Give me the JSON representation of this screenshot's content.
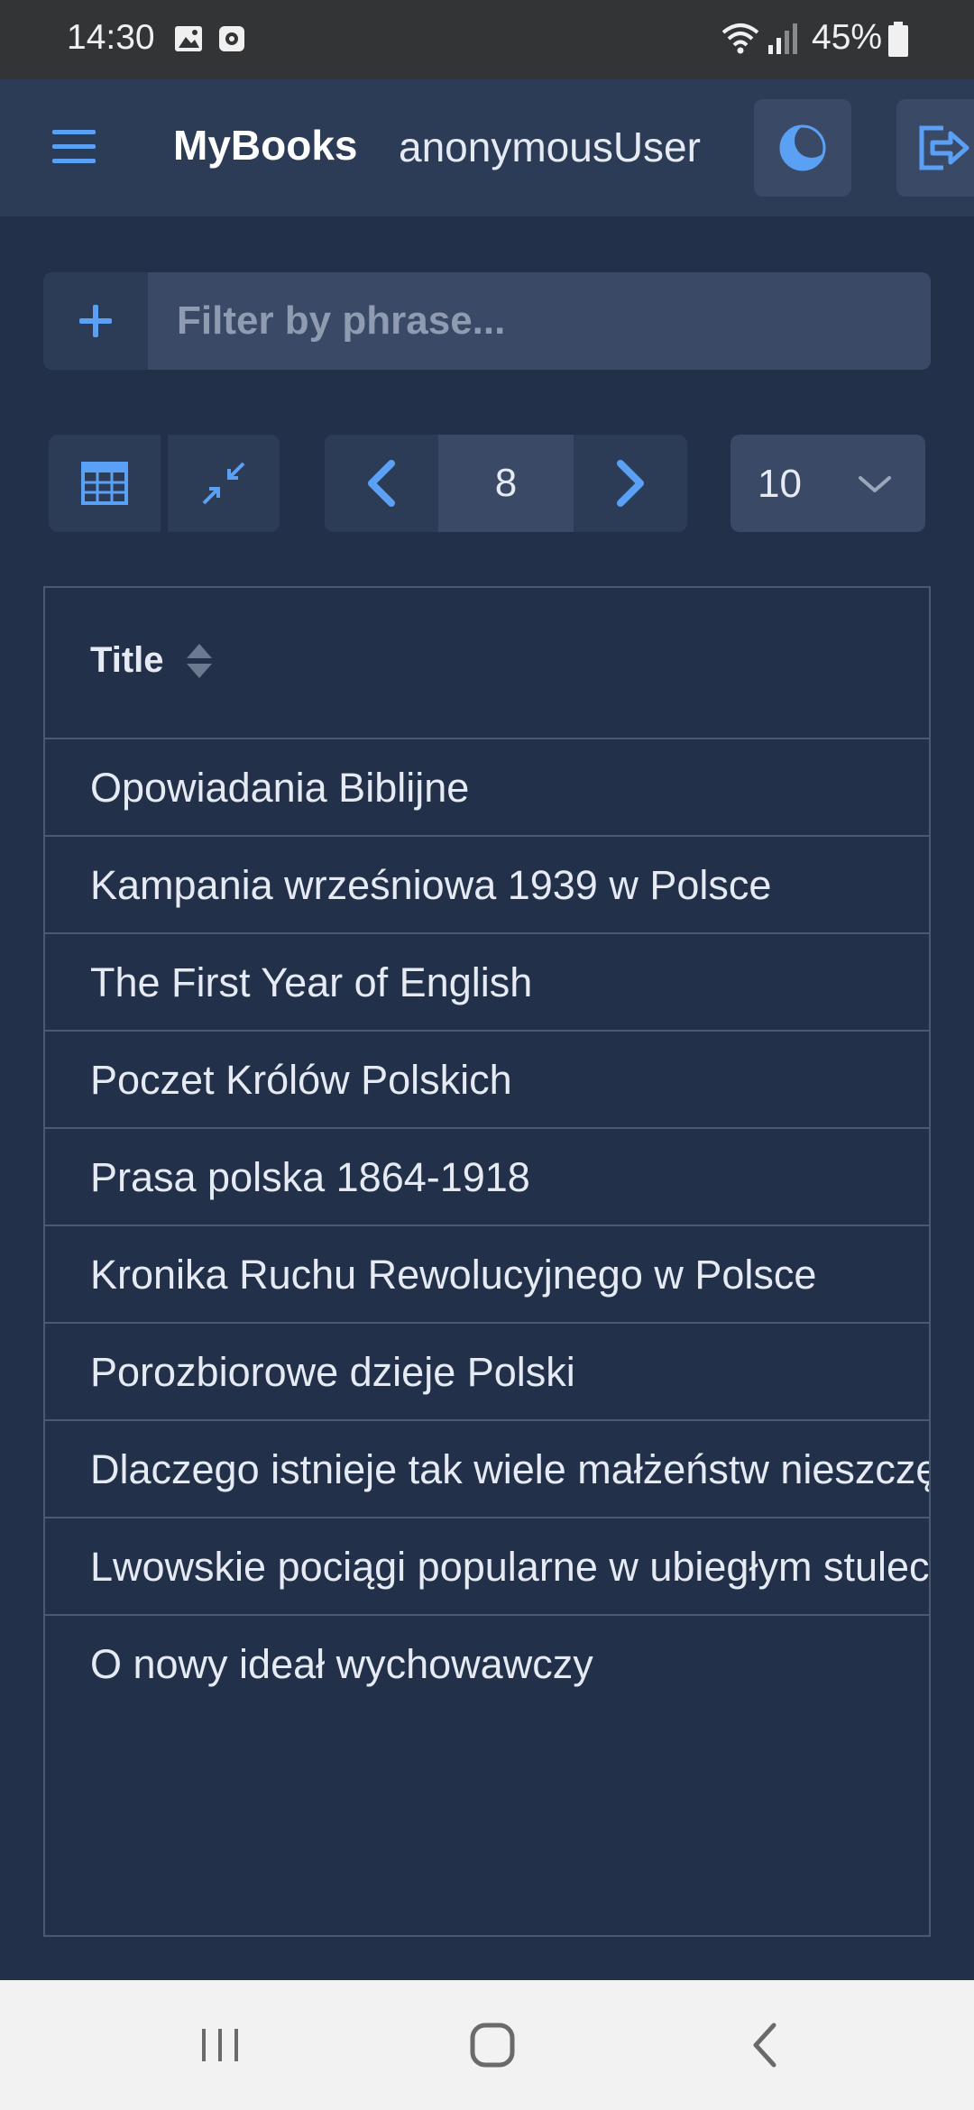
{
  "status_bar": {
    "time": "14:30",
    "battery": "45%",
    "icons": [
      "image-icon",
      "screen-record-icon",
      "wifi-icon",
      "signal-icon",
      "battery-icon"
    ]
  },
  "header": {
    "brand": "MyBooks",
    "user": "anonymousUser",
    "icons": [
      "hamburger-menu-icon",
      "theme-moon-icon",
      "logout-icon"
    ]
  },
  "filter": {
    "placeholder": "Filter by phrase...",
    "value": ""
  },
  "toolbar": {
    "page": "8",
    "page_size": "10"
  },
  "table": {
    "column": "Title",
    "rows": [
      "Opowiadania Biblijne",
      "Kampania wrześniowa 1939 w Polsce",
      "The First Year of English",
      "Poczet Królów Polskich",
      "Prasa polska 1864-1918",
      "Kronika Ruchu Rewolucyjnego w Polsce",
      "Porozbiorowe dzieje Polski",
      "Dlaczego istnieje tak wiele małżeństw nieszczęśliwych",
      "Lwowskie pociągi popularne w ubiegłym stuleciu",
      "O nowy ideał wychowawczy"
    ]
  },
  "colors": {
    "background": "#22304a",
    "header": "#2c3c57",
    "accent": "#5aa0f5",
    "border": "#4b5a72"
  }
}
